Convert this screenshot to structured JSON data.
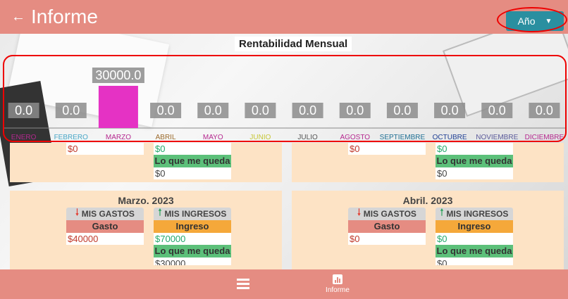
{
  "header": {
    "title": "Informe",
    "year_button": "Año"
  },
  "chart_data": {
    "type": "bar",
    "title": "Rentabilidad Mensual",
    "categories": [
      "ENERO",
      "FEBRERO",
      "MARZO",
      "ABRIL",
      "MAYO",
      "JUNIO",
      "JULIO",
      "AGOSTO",
      "SEPTIEMBRE",
      "OCTUBRE",
      "NOVIEMBRE",
      "DICIEMBRE"
    ],
    "values": [
      0,
      0,
      30000,
      0,
      0,
      0,
      0,
      0,
      0,
      0,
      0,
      0
    ],
    "value_labels": [
      "0.0",
      "0.0",
      "30000.0",
      "0.0",
      "0.0",
      "0.0",
      "0.0",
      "0.0",
      "0.0",
      "0.0",
      "0.0",
      "0.0"
    ],
    "bar_color": "#e532c4",
    "category_colors": [
      "#b5288f",
      "#4aa8c8",
      "#b5288f",
      "#9b6a2c",
      "#b5288f",
      "#c8c83a",
      "#555555",
      "#b5288f",
      "#1e6f94",
      "#1e3f94",
      "#5a5a9a",
      "#b5288f"
    ]
  },
  "top_row": {
    "left": {
      "gasto_value": "$0",
      "ingreso_value": "$0",
      "queda_label": "Lo que me queda",
      "queda_value": "$0"
    },
    "right": {
      "gasto_value": "$0",
      "ingreso_value": "$0",
      "queda_label": "Lo que me queda",
      "queda_value": "$0"
    }
  },
  "months": [
    {
      "title": "Marzo. 2023",
      "gastos_header": "MIS GASTOS",
      "ingresos_header": "MIS INGRESOS",
      "gasto_label": "Gasto",
      "ingreso_label": "Ingreso",
      "gasto_value": "$40000",
      "ingreso_value": "$70000",
      "queda_label": "Lo que me queda",
      "queda_value": "$30000"
    },
    {
      "title": "Abril. 2023",
      "gastos_header": "MIS GASTOS",
      "ingresos_header": "MIS INGRESOS",
      "gasto_label": "Gasto",
      "ingreso_label": "Ingreso",
      "gasto_value": "$0",
      "ingreso_value": "$0",
      "queda_label": "Lo que me queda",
      "queda_value": "$0"
    }
  ],
  "bottom_nav": {
    "informe_label": "Informe"
  },
  "icons": {
    "back": "arrow-left-icon",
    "dropdown": "caret-down-icon",
    "list": "list-icon",
    "informe": "bar-chart-icon",
    "down": "arrow-down-icon",
    "up": "arrow-up-icon"
  }
}
